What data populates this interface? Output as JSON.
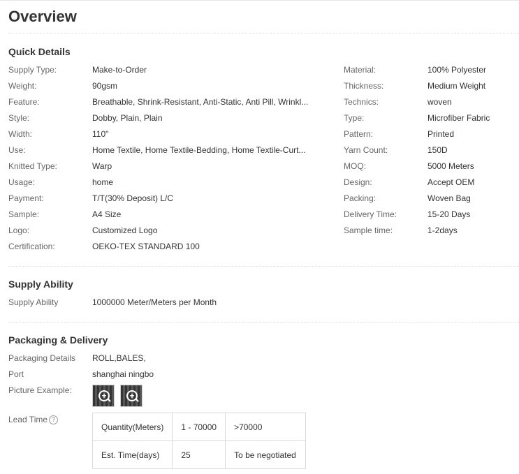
{
  "title": "Overview",
  "quick_details": {
    "heading": "Quick Details",
    "left": [
      {
        "label": "Supply Type:",
        "value": "Make-to-Order"
      },
      {
        "label": "Weight:",
        "value": "90gsm"
      },
      {
        "label": "Feature:",
        "value": "Breathable, Shrink-Resistant, Anti-Static, Anti Pill, Wrinkl..."
      },
      {
        "label": "Style:",
        "value": "Dobby, Plain, Plain"
      },
      {
        "label": "Width:",
        "value": "110\""
      },
      {
        "label": "Use:",
        "value": "Home Textile, Home Textile-Bedding, Home Textile-Curt..."
      },
      {
        "label": "Knitted Type:",
        "value": "Warp"
      },
      {
        "label": "Usage:",
        "value": "home"
      },
      {
        "label": "Payment:",
        "value": "T/T(30% Deposit) L/C"
      },
      {
        "label": "Sample:",
        "value": "A4 Size"
      },
      {
        "label": "Logo:",
        "value": "Customized Logo"
      },
      {
        "label": "Certification:",
        "value": "OEKO-TEX STANDARD 100"
      }
    ],
    "right": [
      {
        "label": "Material:",
        "value": "100% Polyester"
      },
      {
        "label": "Thickness:",
        "value": "Medium Weight"
      },
      {
        "label": "Technics:",
        "value": "woven"
      },
      {
        "label": "Type:",
        "value": "Microfiber Fabric"
      },
      {
        "label": "Pattern:",
        "value": "Printed"
      },
      {
        "label": "Yarn Count:",
        "value": "150D"
      },
      {
        "label": "MOQ:",
        "value": "5000 Meters"
      },
      {
        "label": "Design:",
        "value": "Accept OEM"
      },
      {
        "label": "Packing:",
        "value": "Woven Bag"
      },
      {
        "label": "Delivery Time:",
        "value": "15-20 Days"
      },
      {
        "label": "Sample time:",
        "value": "1-2days"
      }
    ]
  },
  "supply_ability": {
    "heading": "Supply Ability",
    "label": "Supply Ability",
    "value": "1000000 Meter/Meters per Month"
  },
  "packaging": {
    "heading": "Packaging & Delivery",
    "details_label": "Packaging Details",
    "details_value": "ROLL,BALES,",
    "port_label": "Port",
    "port_value": "shanghai ningbo",
    "picture_label": "Picture Example:",
    "picture_icons": [
      "zoom-icon",
      "zoom-icon"
    ],
    "lead_time_label": "Lead Time",
    "help_glyph": "?",
    "lead_table": {
      "row1": [
        "Quantity(Meters)",
        "1 - 70000",
        ">70000"
      ],
      "row2": [
        "Est. Time(days)",
        "25",
        "To be negotiated"
      ]
    }
  }
}
